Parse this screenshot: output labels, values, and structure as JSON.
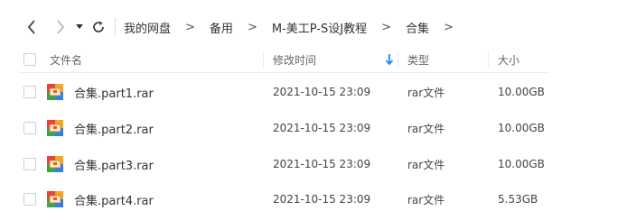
{
  "breadcrumb": {
    "items": [
      "我的网盘",
      "备用",
      "M-美工P-S设J教程",
      "合集"
    ],
    "separator": ">"
  },
  "table": {
    "headers": {
      "name": "文件名",
      "modified": "修改时间",
      "type": "类型",
      "size": "大小"
    },
    "rows": [
      {
        "name": "合集.part1.rar",
        "modified": "2021-10-15 23:09",
        "type": "rar文件",
        "size": "10.00GB"
      },
      {
        "name": "合集.part2.rar",
        "modified": "2021-10-15 23:09",
        "type": "rar文件",
        "size": "10.00GB"
      },
      {
        "name": "合集.part3.rar",
        "modified": "2021-10-15 23:09",
        "type": "rar文件",
        "size": "10.00GB"
      },
      {
        "name": "合集.part4.rar",
        "modified": "2021-10-15 23:09",
        "type": "rar文件",
        "size": "5.53GB"
      }
    ]
  },
  "icons": {
    "back": "chevron-left-icon",
    "forward": "chevron-right-icon",
    "dropdown": "caret-down-icon",
    "refresh": "refresh-icon",
    "sort": "sort-down-arrow-icon",
    "file": "rar-archive-icon"
  },
  "colors": {
    "sort_arrow": "#1a8ef2",
    "archive_icon": [
      "#e9413f",
      "#f5a623",
      "#3fa34d",
      "#2f80ed"
    ]
  }
}
